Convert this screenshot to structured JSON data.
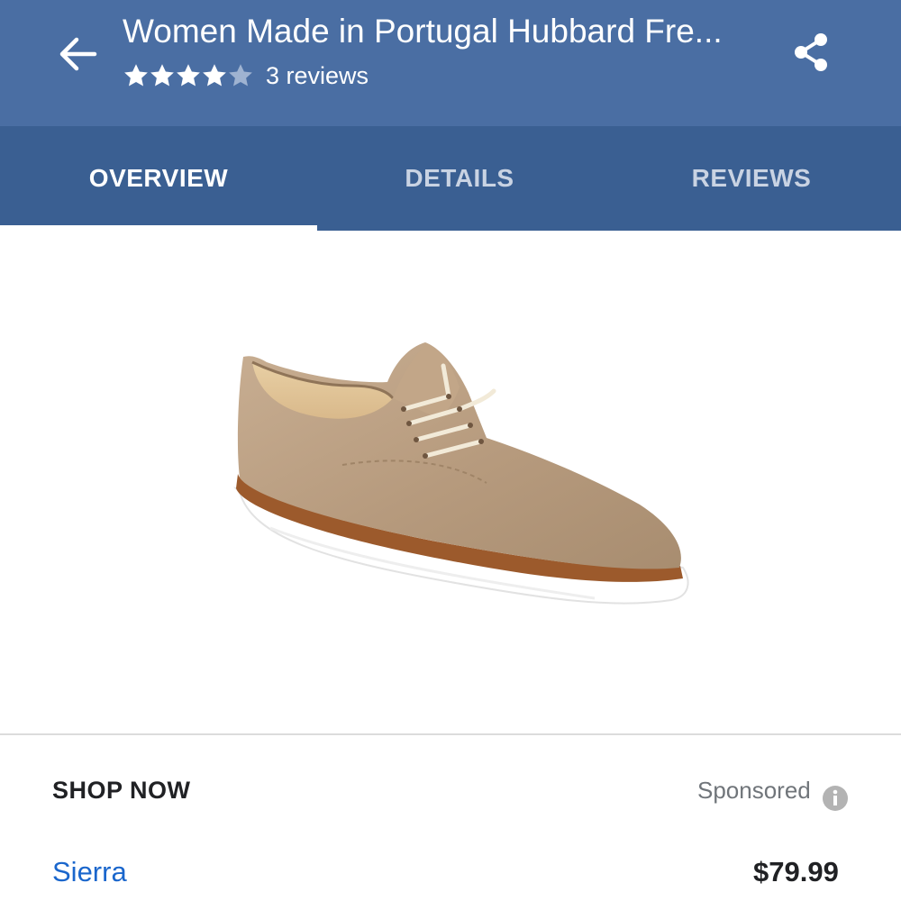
{
  "header": {
    "title": "Women Made in Portugal Hubbard Fre...",
    "rating": 4,
    "rating_max": 5,
    "reviews_label": "3 reviews",
    "back_icon": "arrow-left-icon",
    "share_icon": "share-icon"
  },
  "tabs": [
    {
      "label": "OVERVIEW",
      "selected": true
    },
    {
      "label": "DETAILS",
      "selected": false
    },
    {
      "label": "REVIEWS",
      "selected": false
    }
  ],
  "product": {
    "image": "tan-suede-oxford-shoe"
  },
  "shop": {
    "heading": "SHOP NOW",
    "sponsored_label": "Sponsored",
    "info_icon": "info-icon",
    "offers": [
      {
        "merchant": "Sierra",
        "price": "$79.99"
      }
    ]
  },
  "colors": {
    "app_bar": "#4a6ea3",
    "tab_bar": "#3a5f92",
    "link": "#1a66cc"
  }
}
